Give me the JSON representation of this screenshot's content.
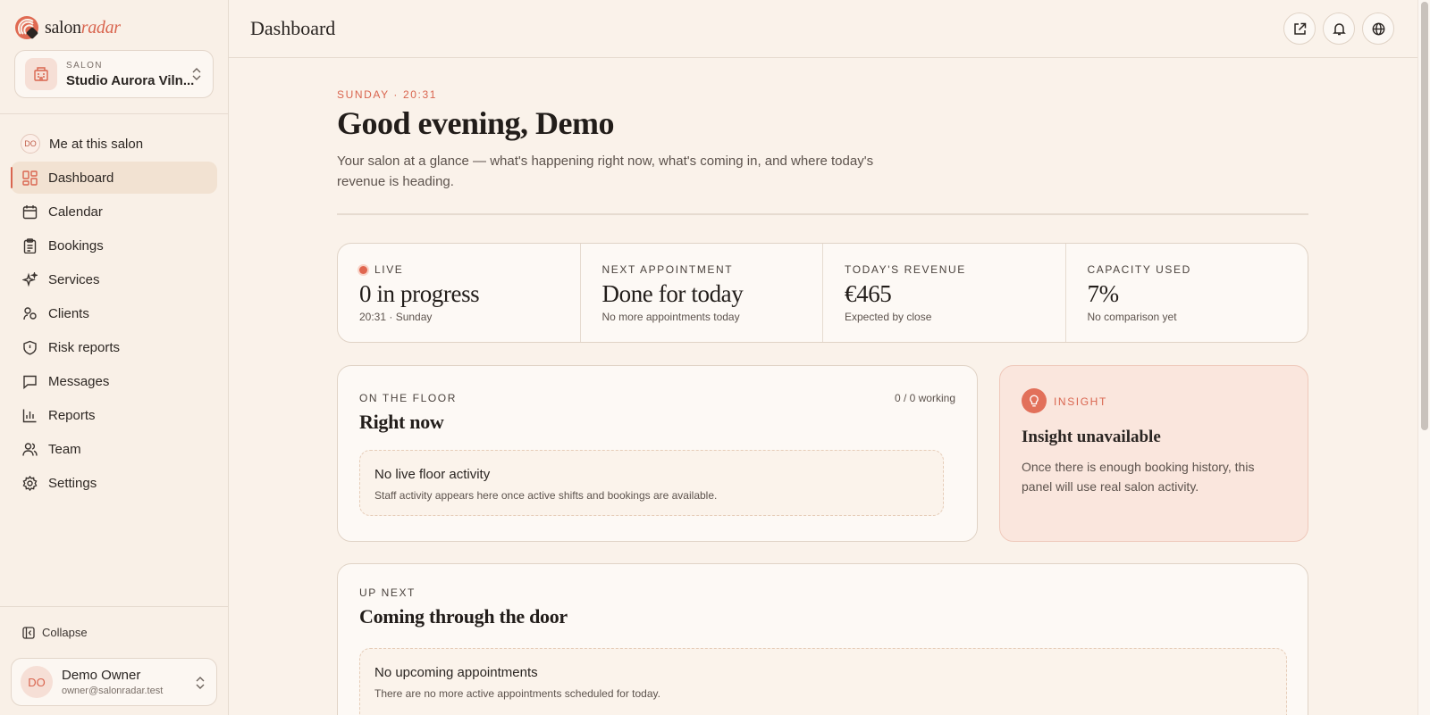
{
  "brand": {
    "name_part1": "salon",
    "name_part2": "radar"
  },
  "salon_switcher": {
    "kicker": "SALON",
    "name": "Studio Aurora Viln..."
  },
  "nav": {
    "me_badge": "DO",
    "me_label": "Me at this salon",
    "items": [
      {
        "label": "Dashboard",
        "icon": "dashboard-icon",
        "active": true
      },
      {
        "label": "Calendar",
        "icon": "calendar-icon"
      },
      {
        "label": "Bookings",
        "icon": "clipboard-icon"
      },
      {
        "label": "Services",
        "icon": "sparkles-icon"
      },
      {
        "label": "Clients",
        "icon": "clients-icon"
      },
      {
        "label": "Risk reports",
        "icon": "shield-icon"
      },
      {
        "label": "Messages",
        "icon": "message-icon"
      },
      {
        "label": "Reports",
        "icon": "bar-chart-icon"
      },
      {
        "label": "Team",
        "icon": "team-icon"
      },
      {
        "label": "Settings",
        "icon": "gear-icon"
      }
    ],
    "collapse_label": "Collapse"
  },
  "user": {
    "initials": "DO",
    "name": "Demo Owner",
    "email": "owner@salonradar.test"
  },
  "topbar": {
    "title": "Dashboard"
  },
  "header": {
    "kicker": "SUNDAY · 20:31",
    "greeting": "Good evening, Demo",
    "lede": "Your salon at a glance — what's happening right now, what's coming in, and where today's revenue is heading."
  },
  "stats": [
    {
      "label": "LIVE",
      "value": "0 in progress",
      "sub": "20:31 · Sunday"
    },
    {
      "label": "NEXT APPOINTMENT",
      "value": "Done for today",
      "sub": "No more appointments today"
    },
    {
      "label": "TODAY'S REVENUE",
      "value": "€465",
      "sub": "Expected by close"
    },
    {
      "label": "CAPACITY USED",
      "value": "7%",
      "sub": "No comparison yet"
    }
  ],
  "floor": {
    "kicker": "ON THE FLOOR",
    "title": "Right now",
    "working": "0 / 0 working",
    "empty_title": "No live floor activity",
    "empty_sub": "Staff activity appears here once active shifts and bookings are available."
  },
  "insight": {
    "kicker": "INSIGHT",
    "title": "Insight unavailable",
    "body": "Once there is enough booking history, this panel will use real salon activity."
  },
  "upnext": {
    "kicker": "UP NEXT",
    "title": "Coming through the door",
    "empty_title": "No upcoming appointments",
    "empty_sub": "There are no more active appointments scheduled for today."
  },
  "colors": {
    "accent": "#d9654f",
    "background": "#faf2ea",
    "card": "#fdf9f5",
    "insight_bg": "#fae6dd"
  }
}
